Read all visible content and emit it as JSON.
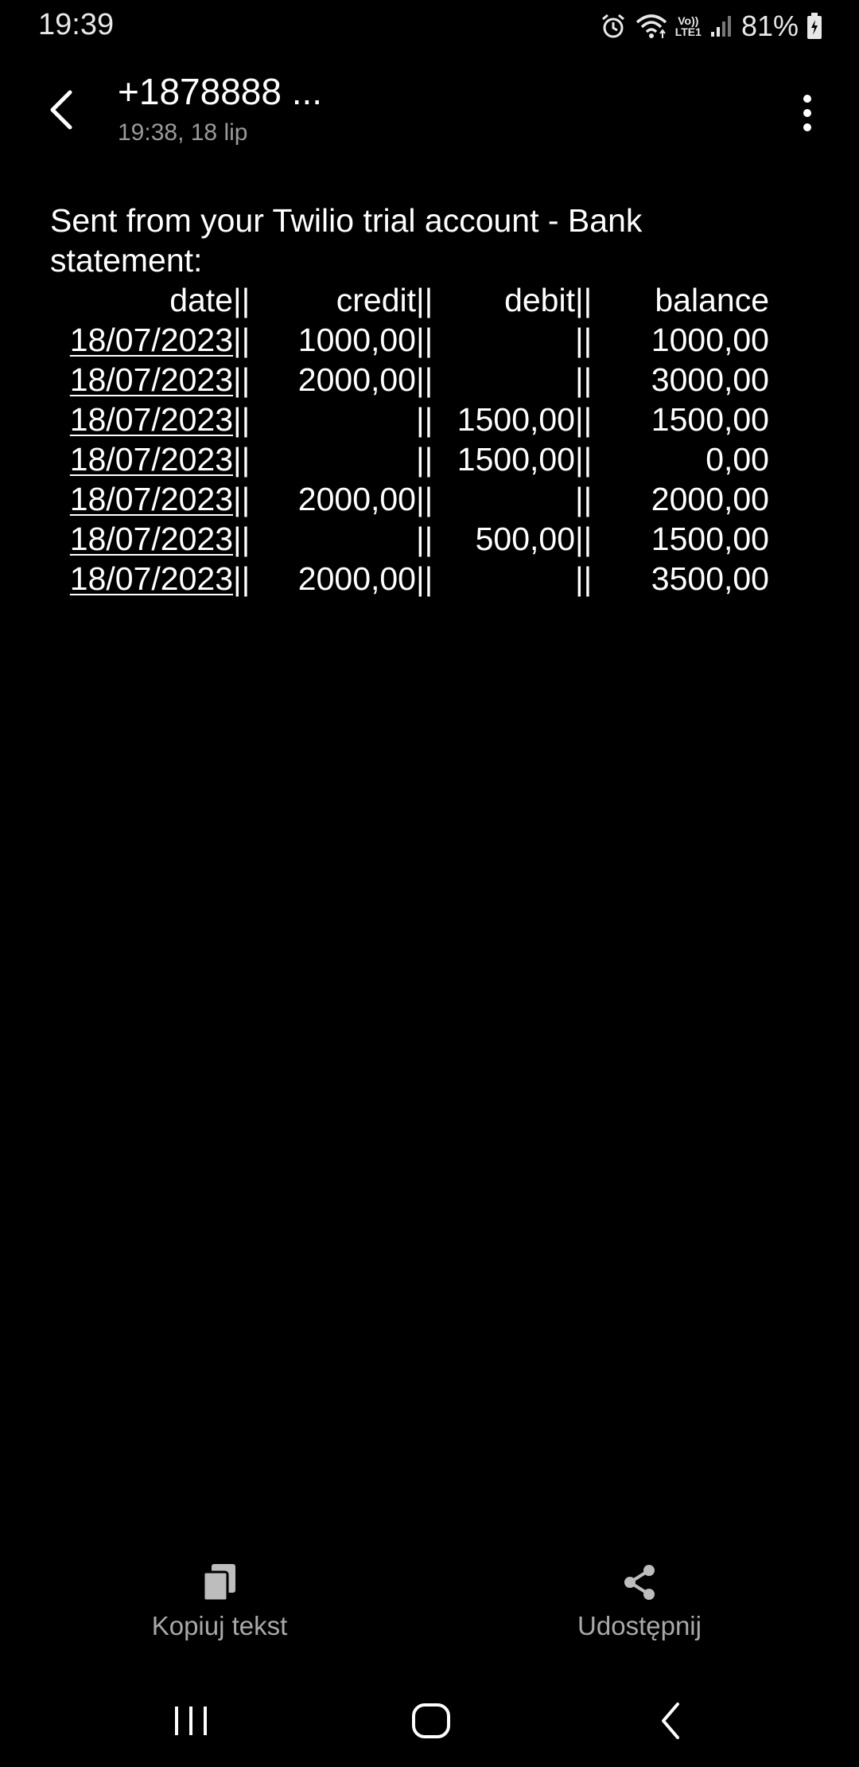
{
  "status_bar": {
    "time": "19:39",
    "battery": "81%",
    "icons": [
      "alarm-icon",
      "wifi-icon",
      "volte-lte-icon",
      "signal-icon",
      "battery-charging-icon"
    ],
    "volte_top": "Vo))",
    "volte_bottom": "LTE1"
  },
  "header": {
    "contact": "+1878888 ...",
    "timestamp": "19:38, 18 lip"
  },
  "message": {
    "intro": "Sent from your Twilio trial account - Bank statement:",
    "table": {
      "headers": [
        "date",
        "credit",
        "debit",
        "balance"
      ],
      "rows": [
        {
          "date": "18/07/2023",
          "credit": "1000,00",
          "debit": "",
          "balance": "1000,00"
        },
        {
          "date": "18/07/2023",
          "credit": "2000,00",
          "debit": "",
          "balance": "3000,00"
        },
        {
          "date": "18/07/2023",
          "credit": "",
          "debit": "1500,00",
          "balance": "1500,00"
        },
        {
          "date": "18/07/2023",
          "credit": "",
          "debit": "1500,00",
          "balance": "0,00"
        },
        {
          "date": "18/07/2023",
          "credit": "2000,00",
          "debit": "",
          "balance": "2000,00"
        },
        {
          "date": "18/07/2023",
          "credit": "",
          "debit": "500,00",
          "balance": "1500,00"
        },
        {
          "date": "18/07/2023",
          "credit": "2000,00",
          "debit": "",
          "balance": "3500,00"
        }
      ],
      "separator": "||"
    }
  },
  "actions": {
    "copy_label": "Kopiuj tekst",
    "share_label": "Udostępnij"
  },
  "colors": {
    "background": "#000000",
    "text": "#ffffff",
    "secondary_text": "#9a9a9a"
  }
}
